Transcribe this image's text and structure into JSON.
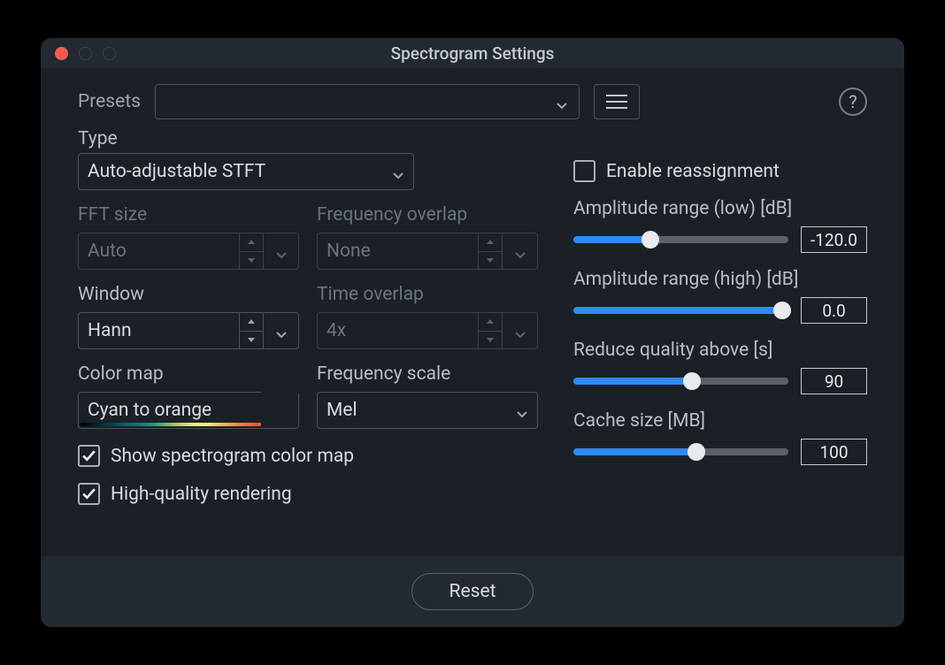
{
  "window": {
    "title": "Spectrogram Settings"
  },
  "presets": {
    "label": "Presets",
    "value": ""
  },
  "type": {
    "label": "Type",
    "value": "Auto-adjustable STFT"
  },
  "fft_size": {
    "label": "FFT size",
    "value": "Auto"
  },
  "frequency_overlap": {
    "label": "Frequency overlap",
    "value": "None"
  },
  "window_fn": {
    "label": "Window",
    "value": "Hann"
  },
  "time_overlap": {
    "label": "Time overlap",
    "value": "4x"
  },
  "color_map": {
    "label": "Color map",
    "value": "Cyan to orange"
  },
  "frequency_scale": {
    "label": "Frequency scale",
    "value": "Mel"
  },
  "show_colormap": {
    "label": "Show spectrogram color map",
    "checked": true
  },
  "hq_rendering": {
    "label": "High-quality rendering",
    "checked": true
  },
  "enable_reassignment": {
    "label": "Enable reassignment",
    "checked": false
  },
  "amp_low": {
    "label": "Amplitude range (low)  [dB]",
    "value": "-120.0",
    "percent": 36
  },
  "amp_high": {
    "label": "Amplitude range (high)  [dB]",
    "value": "0.0",
    "percent": 97
  },
  "reduce_quality": {
    "label": "Reduce quality above [s]",
    "value": "90",
    "percent": 55
  },
  "cache_size": {
    "label": "Cache size [MB]",
    "value": "100",
    "percent": 57
  },
  "footer": {
    "reset_label": "Reset"
  }
}
